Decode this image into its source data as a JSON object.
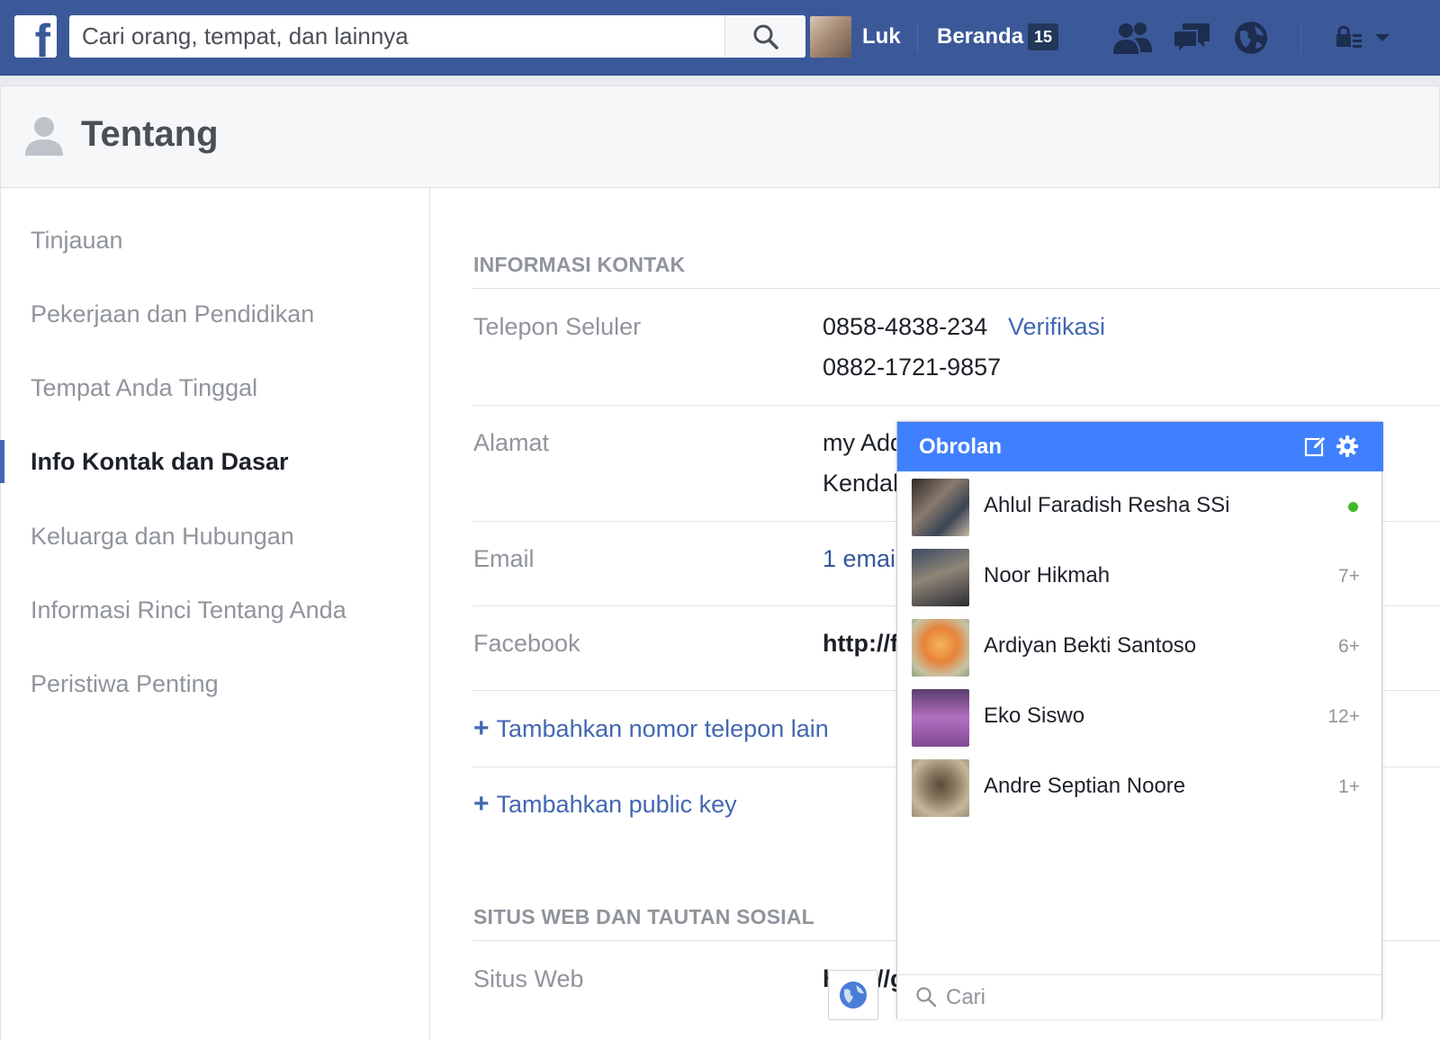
{
  "topbar": {
    "logo": "f",
    "search_placeholder": "Cari orang, tempat, dan lainnya",
    "user_name": "Luk",
    "home_label": "Beranda",
    "home_badge": "15",
    "icons": [
      "search-icon",
      "friends-icon",
      "messages-icon",
      "notifications-globe-icon",
      "lock-icon",
      "chevron-down-icon"
    ]
  },
  "page": {
    "title": "Tentang"
  },
  "sidebar": {
    "items": [
      {
        "label": "Tinjauan"
      },
      {
        "label": "Pekerjaan dan Pendidikan"
      },
      {
        "label": "Tempat Anda Tinggal"
      },
      {
        "label": "Info Kontak dan Dasar",
        "active": true
      },
      {
        "label": "Keluarga dan Hubungan"
      },
      {
        "label": "Informasi Rinci Tentang Anda"
      },
      {
        "label": "Peristiwa Penting"
      }
    ]
  },
  "contact_info": {
    "heading": "INFORMASI KONTAK",
    "phone_label": "Telepon Seluler",
    "phone_1": "0858-4838-234",
    "verify_label": "Verifikasi",
    "phone_2": "0882-1721-9857",
    "address_label": "Alamat",
    "address_line_1": "my Add",
    "address_line_2": "Kendal",
    "email_label": "Email",
    "email_value": "1 email",
    "facebook_label": "Facebook",
    "facebook_value": "http://f",
    "add_phone": "Tambahkan nomor telepon lain",
    "add_key": "Tambahkan public key",
    "add_icon": "+"
  },
  "websites": {
    "heading": "SITUS WEB DAN TAUTAN SOSIAL",
    "site_label": "Situs Web",
    "site_value": "http://g"
  },
  "chat": {
    "title": "Obrolan",
    "search_placeholder": "Cari",
    "contacts": [
      {
        "name": "Ahlul Faradish Resha SSi",
        "meta": "",
        "online": true
      },
      {
        "name": "Noor Hikmah",
        "meta": "7+",
        "online": false
      },
      {
        "name": "Ardiyan Bekti Santoso",
        "meta": "6+",
        "online": false
      },
      {
        "name": "Eko Siswo",
        "meta": "12+",
        "online": false
      },
      {
        "name": "Andre Septian Noore",
        "meta": "1+",
        "online": false
      }
    ]
  },
  "colors": {
    "brand": "#3b5998",
    "chat_header": "#4080ff",
    "link": "#4267b2",
    "online": "#42b72a"
  }
}
